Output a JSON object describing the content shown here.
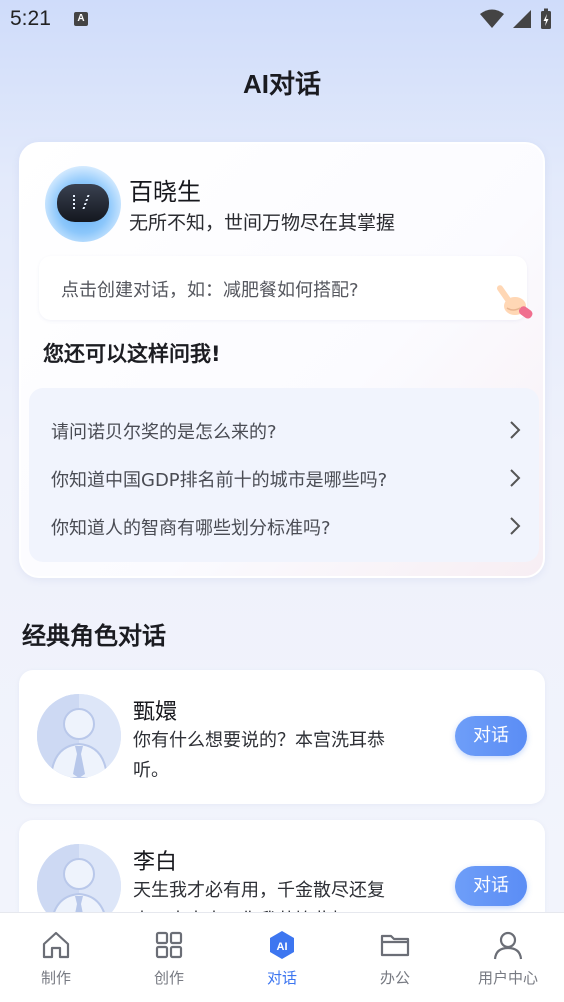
{
  "status_bar": {
    "time": "5:21",
    "notification_badge": "A"
  },
  "page_title": "AI对话",
  "assistant": {
    "name": "百晓生",
    "description": "无所不知，世间万物尽在其掌握",
    "prompt_placeholder": "点击创建对话，如：减肥餐如何搭配?"
  },
  "suggestions": {
    "title": "您还可以这样问我!",
    "items": [
      "请问诺贝尔奖的是怎么来的?",
      "你知道中国GDP排名前十的城市是哪些吗?",
      "你知道人的智商有哪些划分标准吗?"
    ]
  },
  "roles": {
    "title": "经典角色对话",
    "items": [
      {
        "name": "甄嬛",
        "text": "你有什么想要说的？本宫洗耳恭听。",
        "button": "对话"
      },
      {
        "name": "李白",
        "text": "天生我才必有用，千金散尽还复来！来来来，你我共饮此杯。",
        "button": "对话"
      }
    ]
  },
  "nav": {
    "items": [
      {
        "label": "制作",
        "icon": "home-icon",
        "active": false
      },
      {
        "label": "创作",
        "icon": "grid-icon",
        "active": false
      },
      {
        "label": "对话",
        "icon": "ai-icon",
        "active": true
      },
      {
        "label": "办公",
        "icon": "folder-icon",
        "active": false
      },
      {
        "label": "用户中心",
        "icon": "user-icon",
        "active": false
      }
    ]
  },
  "colors": {
    "accent": "#3d76f0",
    "button": "#5b8df5",
    "background": "#e3eafb"
  }
}
